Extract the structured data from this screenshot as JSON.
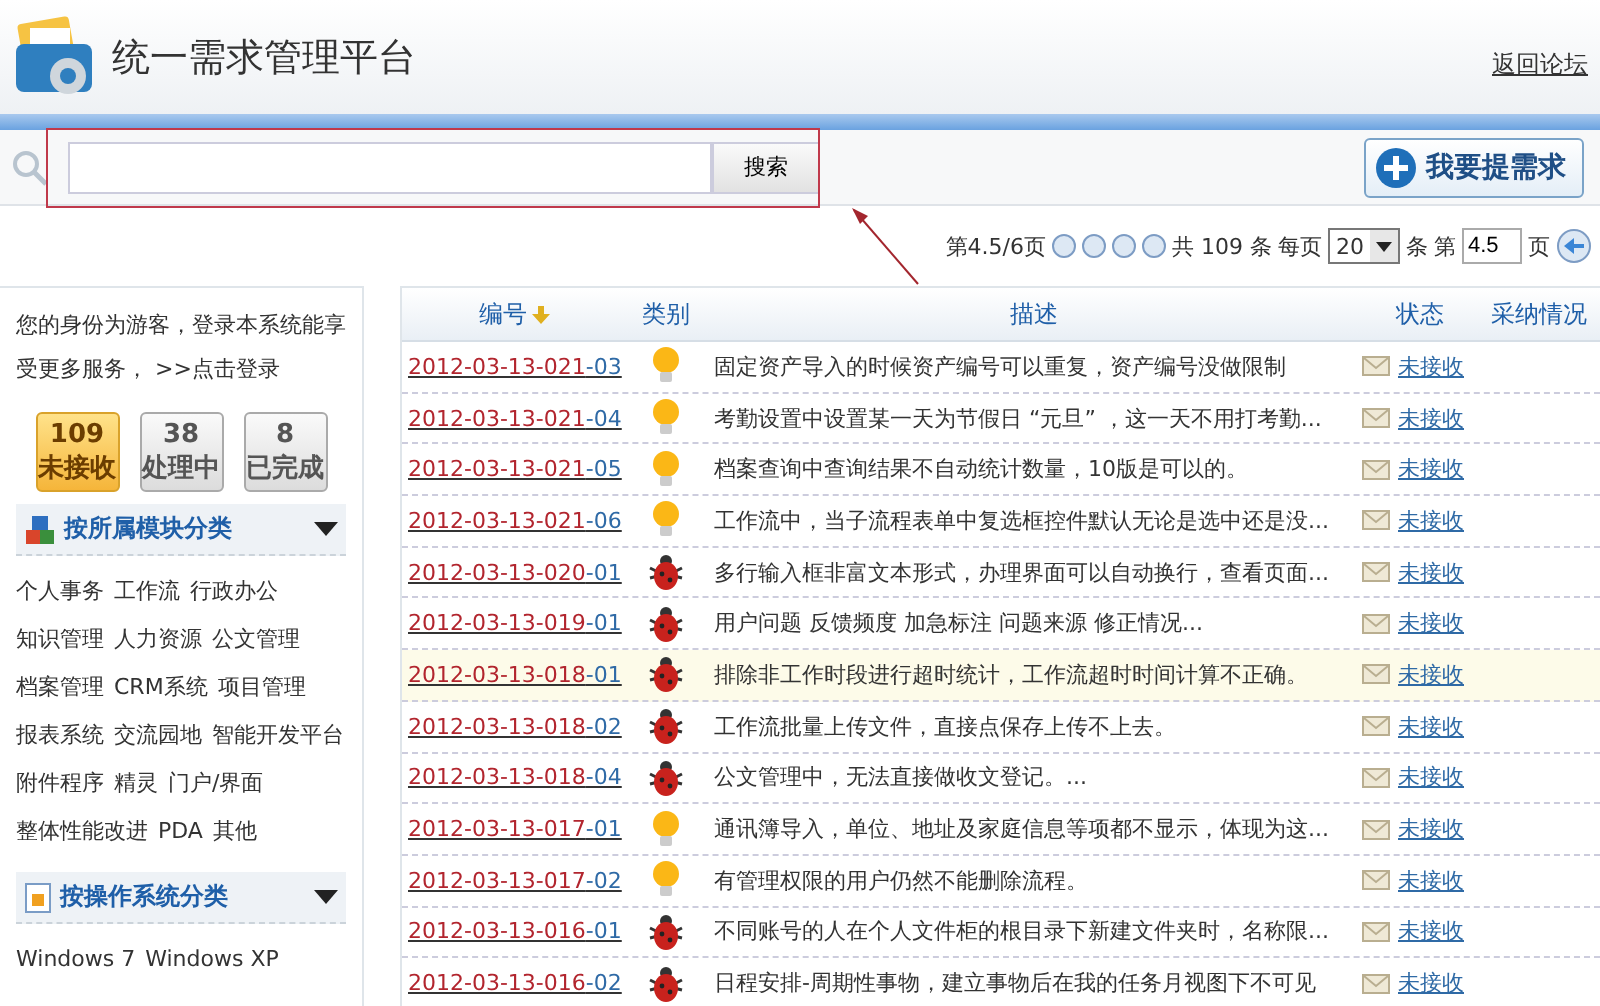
{
  "header": {
    "title": "统一需求管理平台",
    "back_link": "返回论坛"
  },
  "search": {
    "button": "搜索",
    "annotated": true
  },
  "new_request_button": "我要提需求",
  "pagination": {
    "page_info": "第4.5/6页",
    "total_prefix": "共",
    "total": "109",
    "total_suffix": "条",
    "per_page_label": "每页",
    "per_page": "20",
    "per_page_unit": "条",
    "goto_label": "第",
    "goto_value": "4.5",
    "goto_unit": "页"
  },
  "sidebar": {
    "notice": "您的身份为游客，登录本系统能享受更多服务，",
    "login_link": ">>点击登录",
    "counters": [
      {
        "count": "109",
        "label": "未接收",
        "selected": true
      },
      {
        "count": "38",
        "label": "处理中",
        "selected": false
      },
      {
        "count": "8",
        "label": "已完成",
        "selected": false
      }
    ],
    "sections": [
      {
        "title": "按所属模块分类",
        "kind": "module",
        "items": [
          "个人事务",
          "工作流",
          "行政办公",
          "知识管理",
          "人力资源",
          "公文管理",
          "档案管理",
          "CRM系统",
          "项目管理",
          "报表系统",
          "交流园地",
          "智能开发平台",
          "附件程序",
          "精灵",
          "门户/界面",
          "整体性能改进",
          "PDA",
          "其他"
        ]
      },
      {
        "title": "按操作系统分类",
        "kind": "os",
        "items": [
          "Windows 7",
          "Windows XP"
        ]
      }
    ]
  },
  "table": {
    "columns": [
      "编号",
      "类别",
      "描述",
      "状态",
      "采纳情况"
    ],
    "rows": [
      {
        "id_main": "2012-03-13-021",
        "id_suffix": "-03",
        "kind": "idea",
        "description": "固定资产导入的时候资产编号可以重复，资产编号没做限制",
        "status": "未接收",
        "selected": false
      },
      {
        "id_main": "2012-03-13-021",
        "id_suffix": "-04",
        "kind": "idea",
        "description": "考勤设置中设置某一天为节假日 “元旦” ，这一天不用打考勤...",
        "status": "未接收",
        "selected": false
      },
      {
        "id_main": "2012-03-13-021",
        "id_suffix": "-05",
        "kind": "idea",
        "description": "档案查询中查询结果不自动统计数量，10版是可以的。",
        "status": "未接收",
        "selected": false
      },
      {
        "id_main": "2012-03-13-021",
        "id_suffix": "-06",
        "kind": "idea",
        "description": "工作流中，当子流程表单中复选框控件默认无论是选中还是没...",
        "status": "未接收",
        "selected": false
      },
      {
        "id_main": "2012-03-13-020",
        "id_suffix": "-01",
        "kind": "bug",
        "description": "多行输入框非富文本形式，办理界面可以自动换行，查看页面...",
        "status": "未接收",
        "selected": false
      },
      {
        "id_main": "2012-03-13-019",
        "id_suffix": "-01",
        "kind": "bug",
        "description": "用户问题 反馈频度 加急标注 问题来源 修正情况...",
        "status": "未接收",
        "selected": false
      },
      {
        "id_main": "2012-03-13-018",
        "id_suffix": "-01",
        "kind": "bug",
        "description": "排除非工作时段进行超时统计，工作流超时时间计算不正确。",
        "status": "未接收",
        "selected": true
      },
      {
        "id_main": "2012-03-13-018",
        "id_suffix": "-02",
        "kind": "bug",
        "description": "工作流批量上传文件，直接点保存上传不上去。",
        "status": "未接收",
        "selected": false
      },
      {
        "id_main": "2012-03-13-018",
        "id_suffix": "-04",
        "kind": "bug",
        "description": "公文管理中，无法直接做收文登记。...",
        "status": "未接收",
        "selected": false
      },
      {
        "id_main": "2012-03-13-017",
        "id_suffix": "-01",
        "kind": "idea",
        "description": "通讯簿导入，单位、地址及家庭信息等项都不显示，体现为这...",
        "status": "未接收",
        "selected": false
      },
      {
        "id_main": "2012-03-13-017",
        "id_suffix": "-02",
        "kind": "idea",
        "description": "有管理权限的用户仍然不能删除流程。",
        "status": "未接收",
        "selected": false
      },
      {
        "id_main": "2012-03-13-016",
        "id_suffix": "-01",
        "kind": "bug",
        "description": "不同账号的人在个人文件柜的根目录下新建文件夹时，名称限...",
        "status": "未接收",
        "selected": false
      },
      {
        "id_main": "2012-03-13-016",
        "id_suffix": "-02",
        "kind": "bug",
        "description": "日程安排-周期性事物，建立事物后在我的任务月视图下不可见",
        "status": "未接收",
        "selected": false
      }
    ]
  }
}
